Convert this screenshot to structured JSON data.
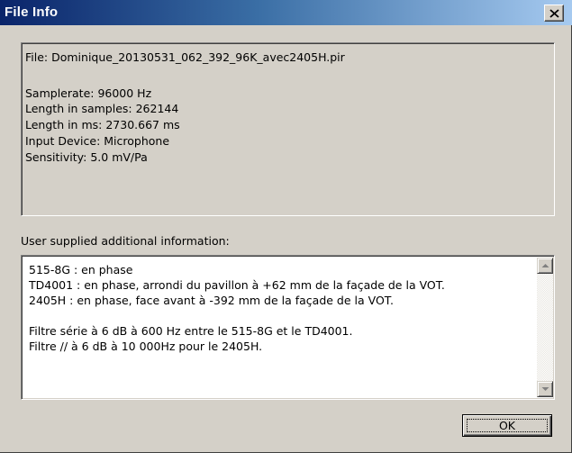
{
  "window": {
    "title": "File Info",
    "close_icon": "close-icon"
  },
  "info": {
    "file": "File: Dominique_20130531_062_392_96K_avec2405H.pir",
    "samplerate": "Samplerate: 96000 Hz",
    "length_samples": "Length in samples: 262144",
    "length_ms": "Length in ms: 2730.667 ms",
    "input_device": "Input Device: Microphone",
    "sensitivity": "Sensitivity: 5.0 mV/Pa"
  },
  "additional": {
    "label": "User supplied additional information:",
    "lines": [
      "515-8G : en phase",
      "TD4001 : en phase, arrondi du pavillon à +62 mm de la façade de la VOT.",
      "2405H : en phase, face avant à -392 mm de la façade de la VOT.",
      "",
      "Filtre série à 6 dB à 600 Hz entre le 515-8G et le TD4001.",
      "Filtre // à 6 dB à 10 000Hz pour le 2405H."
    ]
  },
  "buttons": {
    "ok_label": "OK"
  },
  "colors": {
    "title_gradient_start": "#0a246a",
    "title_gradient_end": "#a6caf0",
    "face": "#d4d0c8"
  }
}
